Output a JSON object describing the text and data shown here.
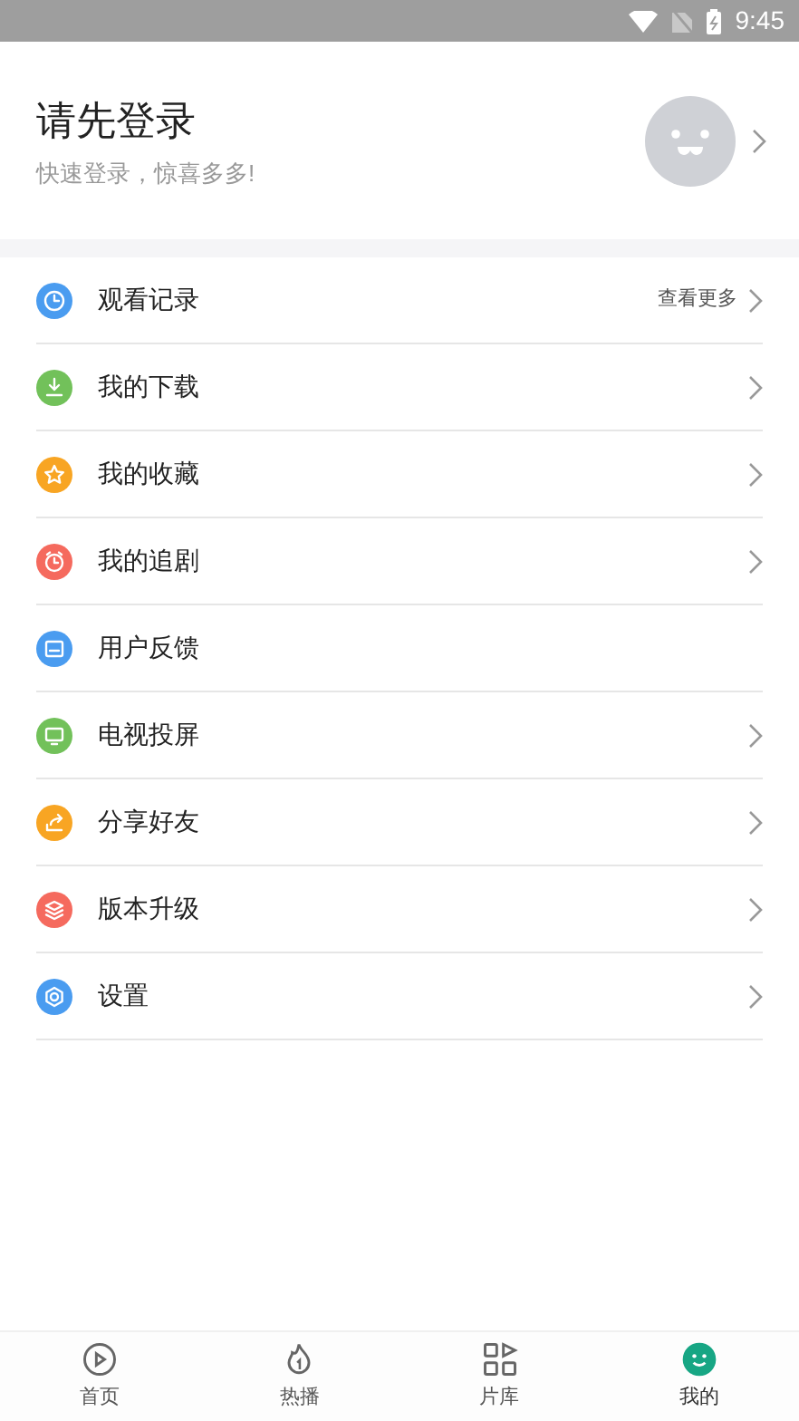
{
  "status_bar": {
    "time": "9:45"
  },
  "profile": {
    "title": "请先登录",
    "subtitle": "快速登录，惊喜多多!"
  },
  "menu": [
    {
      "label": "观看记录",
      "color": "#4a9cf0",
      "more": "查看更多",
      "arrow": true
    },
    {
      "label": "我的下载",
      "color": "#72c15a",
      "arrow": true
    },
    {
      "label": "我的收藏",
      "color": "#f8a523",
      "arrow": true
    },
    {
      "label": "我的追剧",
      "color": "#f56a5e",
      "arrow": true
    },
    {
      "label": "用户反馈",
      "color": "#4a9cf0",
      "arrow": false
    },
    {
      "label": "电视投屏",
      "color": "#72c15a",
      "arrow": true
    },
    {
      "label": "分享好友",
      "color": "#f8a523",
      "arrow": true
    },
    {
      "label": "版本升级",
      "color": "#f56a5e",
      "arrow": true
    },
    {
      "label": "设置",
      "color": "#4a9cf0",
      "arrow": true
    }
  ],
  "tabs": [
    {
      "label": "首页",
      "selected": false
    },
    {
      "label": "热播",
      "selected": false
    },
    {
      "label": "片库",
      "selected": false
    },
    {
      "label": "我的",
      "selected": true
    }
  ]
}
